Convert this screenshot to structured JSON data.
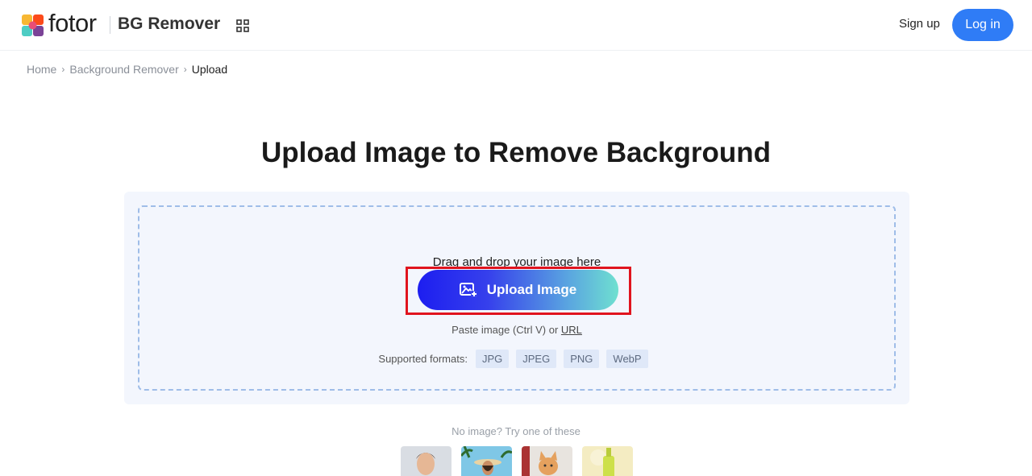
{
  "header": {
    "logo_text": "fotor",
    "product_name": "BG Remover",
    "apps_icon": "grid-apps-icon",
    "signup_label": "Sign up",
    "login_label": "Log in",
    "accent": "#2f7cf6"
  },
  "breadcrumb": {
    "items": [
      "Home",
      "Background Remover"
    ],
    "current": "Upload"
  },
  "main": {
    "title": "Upload Image to Remove Background",
    "drag_text": "Drag and drop your image here",
    "upload_button_label": "Upload Image",
    "upload_icon": "add-image-icon",
    "paste_text": "Paste image (Ctrl V) or",
    "url_link": "URL",
    "formats_label": "Supported formats:",
    "formats": [
      "JPG",
      "JPEG",
      "PNG",
      "WebP"
    ],
    "highlight_color": "#e0141e"
  },
  "samples": {
    "label": "No image? Try one of these",
    "items": [
      "man-portrait",
      "woman-beach",
      "cat",
      "product-bottle"
    ]
  }
}
